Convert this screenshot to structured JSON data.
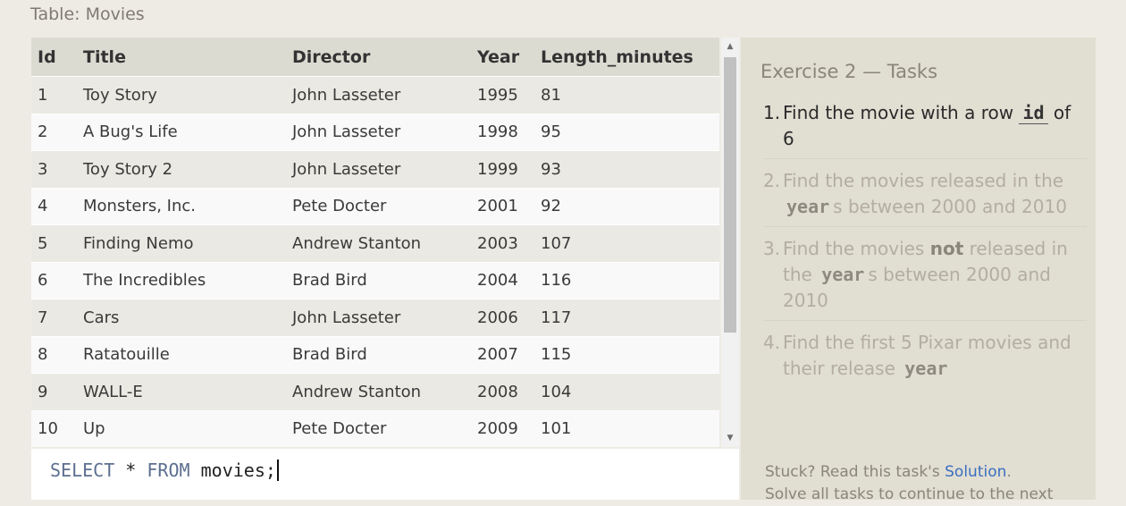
{
  "table": {
    "caption": "Table: Movies",
    "columns": [
      "Id",
      "Title",
      "Director",
      "Year",
      "Length_minutes"
    ],
    "rows": [
      [
        "1",
        "Toy Story",
        "John Lasseter",
        "1995",
        "81"
      ],
      [
        "2",
        "A Bug's Life",
        "John Lasseter",
        "1998",
        "95"
      ],
      [
        "3",
        "Toy Story 2",
        "John Lasseter",
        "1999",
        "93"
      ],
      [
        "4",
        "Monsters, Inc.",
        "Pete Docter",
        "2001",
        "92"
      ],
      [
        "5",
        "Finding Nemo",
        "Andrew Stanton",
        "2003",
        "107"
      ],
      [
        "6",
        "The Incredibles",
        "Brad Bird",
        "2004",
        "116"
      ],
      [
        "7",
        "Cars",
        "John Lasseter",
        "2006",
        "117"
      ],
      [
        "8",
        "Ratatouille",
        "Brad Bird",
        "2007",
        "115"
      ],
      [
        "9",
        "WALL-E",
        "Andrew Stanton",
        "2008",
        "104"
      ],
      [
        "10",
        "Up",
        "Pete Docter",
        "2009",
        "101"
      ]
    ]
  },
  "editor": {
    "kw_select": "SELECT",
    "star": "*",
    "kw_from": "FROM",
    "table_name": "movies;"
  },
  "tasks": {
    "title": "Exercise 2 — Tasks",
    "items": [
      {
        "num": "1.",
        "pre": "Find the movie with a row ",
        "code": "id",
        "post": " of 6"
      },
      {
        "num": "2.",
        "pre": "Find the movies released in the ",
        "code": "year",
        "post": "s between 2000 and 2010"
      },
      {
        "num": "3.",
        "pre": "Find the movies ",
        "bold": "not",
        "mid": " released in the ",
        "code": "year",
        "post": "s between 2000 and 2010"
      },
      {
        "num": "4.",
        "pre": "Find the first 5 Pixar movies and their release ",
        "code": "year",
        "post": ""
      }
    ]
  },
  "help": {
    "stuck_pre": "Stuck? Read this task's ",
    "solution_link": "Solution",
    "stuck_post": ".",
    "continue_text": "Solve all tasks to continue to the next"
  },
  "colors": {
    "background": "#eeebe4",
    "task_panel": "#e1ded2",
    "link": "#3b6fc0",
    "keyword": "#5d6f8f"
  }
}
